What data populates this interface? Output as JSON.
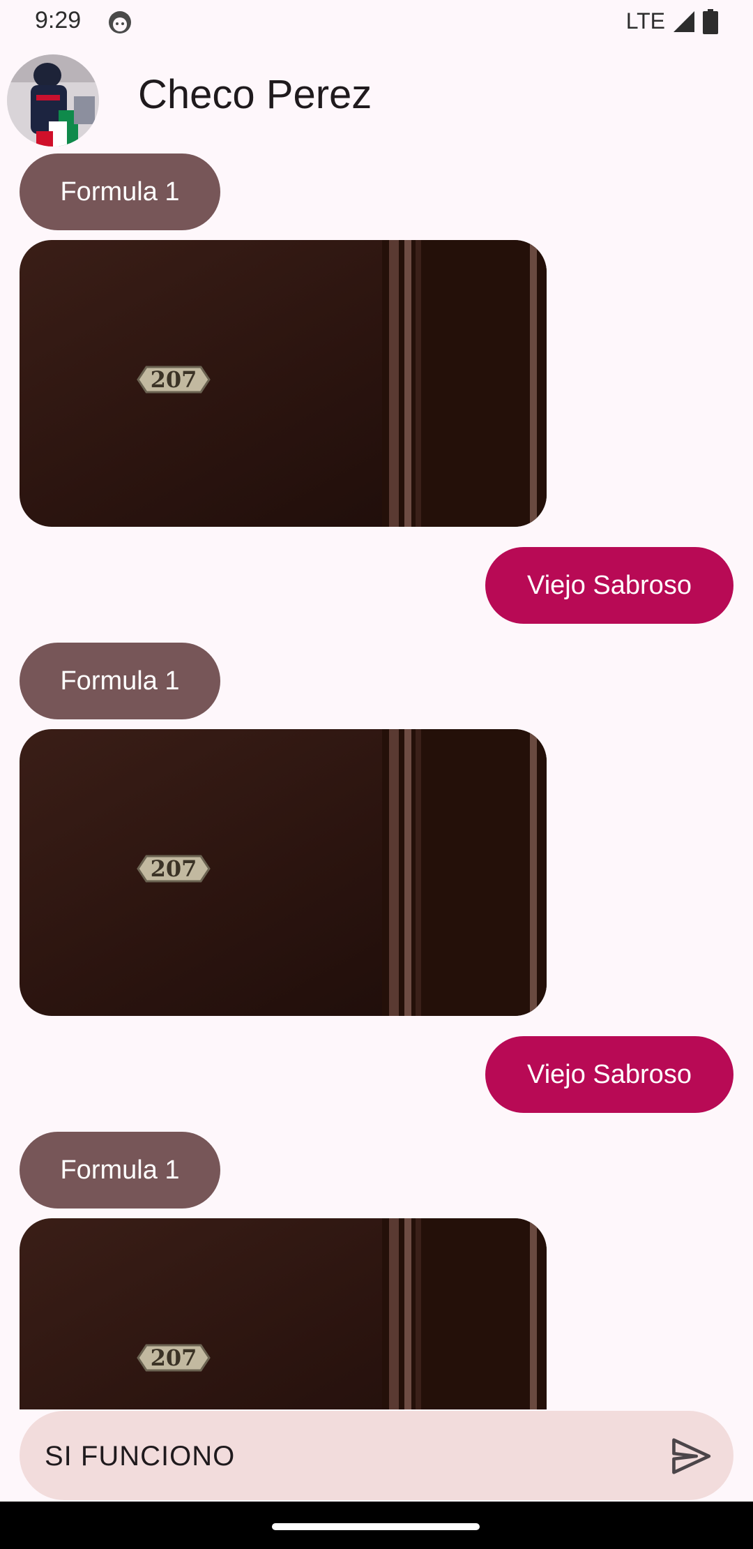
{
  "status_bar": {
    "time": "9:29",
    "network": "LTE",
    "icons": [
      "android-face-icon",
      "signal-icon",
      "battery-icon"
    ]
  },
  "header": {
    "title": "Checo Perez",
    "avatar": "contact-avatar"
  },
  "messages": [
    {
      "type": "received",
      "text": "Formula 1"
    },
    {
      "type": "image",
      "plate": "207"
    },
    {
      "type": "sent",
      "text": "Viejo Sabroso"
    },
    {
      "type": "received",
      "text": "Formula 1"
    },
    {
      "type": "image",
      "plate": "207"
    },
    {
      "type": "sent",
      "text": "Viejo Sabroso"
    },
    {
      "type": "received",
      "text": "Formula 1"
    },
    {
      "type": "image",
      "plate": "207"
    }
  ],
  "composer": {
    "value": "SI FUNCIONO",
    "send_icon": "send-icon"
  },
  "colors": {
    "background": "#fef7fb",
    "received_bubble": "#775658",
    "sent_bubble": "#b80a55",
    "composer": "#f2dcdc"
  }
}
